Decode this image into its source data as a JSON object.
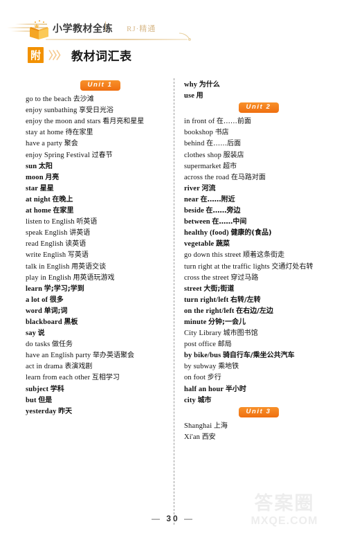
{
  "header": {
    "brand_title": "小学教材全练",
    "edition": "RJ·精通",
    "book_icon": "open-book-icon",
    "swish_icon": "swoosh-icon"
  },
  "section": {
    "badge": "附",
    "arrows": "〉〉〉",
    "title": "教材词汇表"
  },
  "columns": [
    {
      "name": "left",
      "blocks": [
        {
          "type": "unit",
          "label": "Unit 1"
        },
        {
          "type": "entries",
          "items": [
            {
              "en": "go to the beach",
              "cn": "去沙滩",
              "bold": false
            },
            {
              "en": "enjoy sunbathing",
              "cn": "享受日光浴",
              "bold": false
            },
            {
              "en": "enjoy the moon and stars",
              "cn": "看月亮和星星",
              "bold": false
            },
            {
              "en": "stay at home",
              "cn": "待在家里",
              "bold": false
            },
            {
              "en": "have a party",
              "cn": "聚会",
              "bold": false
            },
            {
              "en": "enjoy Spring Festival",
              "cn": "过春节",
              "bold": false
            },
            {
              "en": "sun",
              "cn": "太阳",
              "bold": true
            },
            {
              "en": "moon",
              "cn": "月亮",
              "bold": true
            },
            {
              "en": "star",
              "cn": "星星",
              "bold": true
            },
            {
              "en": "at night",
              "cn": "在晚上",
              "bold": true
            },
            {
              "en": "at home",
              "cn": "在家里",
              "bold": true
            },
            {
              "en": "listen to English",
              "cn": "听英语",
              "bold": false
            },
            {
              "en": "speak English",
              "cn": "讲英语",
              "bold": false
            },
            {
              "en": "read English",
              "cn": "读英语",
              "bold": false
            },
            {
              "en": "write English",
              "cn": "写英语",
              "bold": false
            },
            {
              "en": "talk in English",
              "cn": "用英语交谈",
              "bold": false
            },
            {
              "en": "play in English",
              "cn": "用英语玩游戏",
              "bold": false
            },
            {
              "en": "learn",
              "cn": "学;学习;学到",
              "bold": true
            },
            {
              "en": "a lot of",
              "cn": "很多",
              "bold": true
            },
            {
              "en": "word",
              "cn": "单词;词",
              "bold": true
            },
            {
              "en": "blackboard",
              "cn": "黑板",
              "bold": true
            },
            {
              "en": "say",
              "cn": "说",
              "bold": true
            },
            {
              "en": "do tasks",
              "cn": "做任务",
              "bold": false
            },
            {
              "en": "have an English party",
              "cn": "举办英语聚会",
              "bold": false
            },
            {
              "en": "act in drama",
              "cn": "表演戏剧",
              "bold": false
            },
            {
              "en": "learn from each other",
              "cn": "互相学习",
              "bold": false
            },
            {
              "en": "subject",
              "cn": "学科",
              "bold": true
            },
            {
              "en": "but",
              "cn": "但是",
              "bold": true
            },
            {
              "en": "yesterday",
              "cn": "昨天",
              "bold": true
            }
          ]
        }
      ]
    },
    {
      "name": "right",
      "blocks": [
        {
          "type": "entries",
          "items": [
            {
              "en": "why",
              "cn": "为什么",
              "bold": true
            },
            {
              "en": "use",
              "cn": "用",
              "bold": true
            }
          ]
        },
        {
          "type": "unit",
          "label": "Unit 2"
        },
        {
          "type": "entries",
          "items": [
            {
              "en": "in front of",
              "cn": "在……前面",
              "bold": false
            },
            {
              "en": "bookshop",
              "cn": "书店",
              "bold": false
            },
            {
              "en": "behind",
              "cn": "在……后面",
              "bold": false
            },
            {
              "en": "clothes shop",
              "cn": "服装店",
              "bold": false
            },
            {
              "en": "supermarket",
              "cn": "超市",
              "bold": false
            },
            {
              "en": "across the road",
              "cn": "在马路对面",
              "bold": false
            },
            {
              "en": "river",
              "cn": "河流",
              "bold": true
            },
            {
              "en": "near",
              "cn": "在……附近",
              "bold": true
            },
            {
              "en": "beside",
              "cn": "在……旁边",
              "bold": true
            },
            {
              "en": "between",
              "cn": "在……中间",
              "bold": true
            },
            {
              "en": "healthy (food)",
              "cn": "健康的(食品)",
              "bold": true
            },
            {
              "en": "vegetable",
              "cn": "蔬菜",
              "bold": true
            },
            {
              "en": "go down this street",
              "cn": "顺着这条街走",
              "bold": false
            },
            {
              "en": "turn right at the traffic lights",
              "cn": "交通灯处右转",
              "bold": false
            },
            {
              "en": "cross the street",
              "cn": "穿过马路",
              "bold": false
            },
            {
              "en": "street",
              "cn": "大街;街道",
              "bold": true
            },
            {
              "en": "turn right/left",
              "cn": "右转/左转",
              "bold": true
            },
            {
              "en": "on the right/left",
              "cn": "在右边/左边",
              "bold": true
            },
            {
              "en": "minute",
              "cn": "分钟;一会儿",
              "bold": true
            },
            {
              "en": "City Library",
              "cn": "城市图书馆",
              "bold": false
            },
            {
              "en": "post office",
              "cn": "邮局",
              "bold": false
            },
            {
              "en": "by bike/bus",
              "cn": "骑自行车/乘坐公共汽车",
              "bold": true
            },
            {
              "en": "by subway",
              "cn": "乘地铁",
              "bold": false
            },
            {
              "en": "on foot",
              "cn": "步行",
              "bold": false
            },
            {
              "en": "half an hour",
              "cn": "半小时",
              "bold": true
            },
            {
              "en": "city",
              "cn": "城市",
              "bold": true
            }
          ]
        },
        {
          "type": "unit",
          "label": "Unit 3"
        },
        {
          "type": "entries",
          "items": [
            {
              "en": "Shanghai",
              "cn": "上海",
              "bold": false
            },
            {
              "en": "Xi'an",
              "cn": "西安",
              "bold": false
            }
          ]
        }
      ]
    }
  ],
  "footer": {
    "left_dash": "—",
    "page_number": "30",
    "right_dash": "—"
  },
  "watermark": {
    "line1": "答案圈",
    "line2": "MXQE.COM"
  },
  "colors": {
    "accent_orange": "#f29100",
    "unit_badge": "#ef6f10",
    "header_gold": "#d8b98a"
  }
}
